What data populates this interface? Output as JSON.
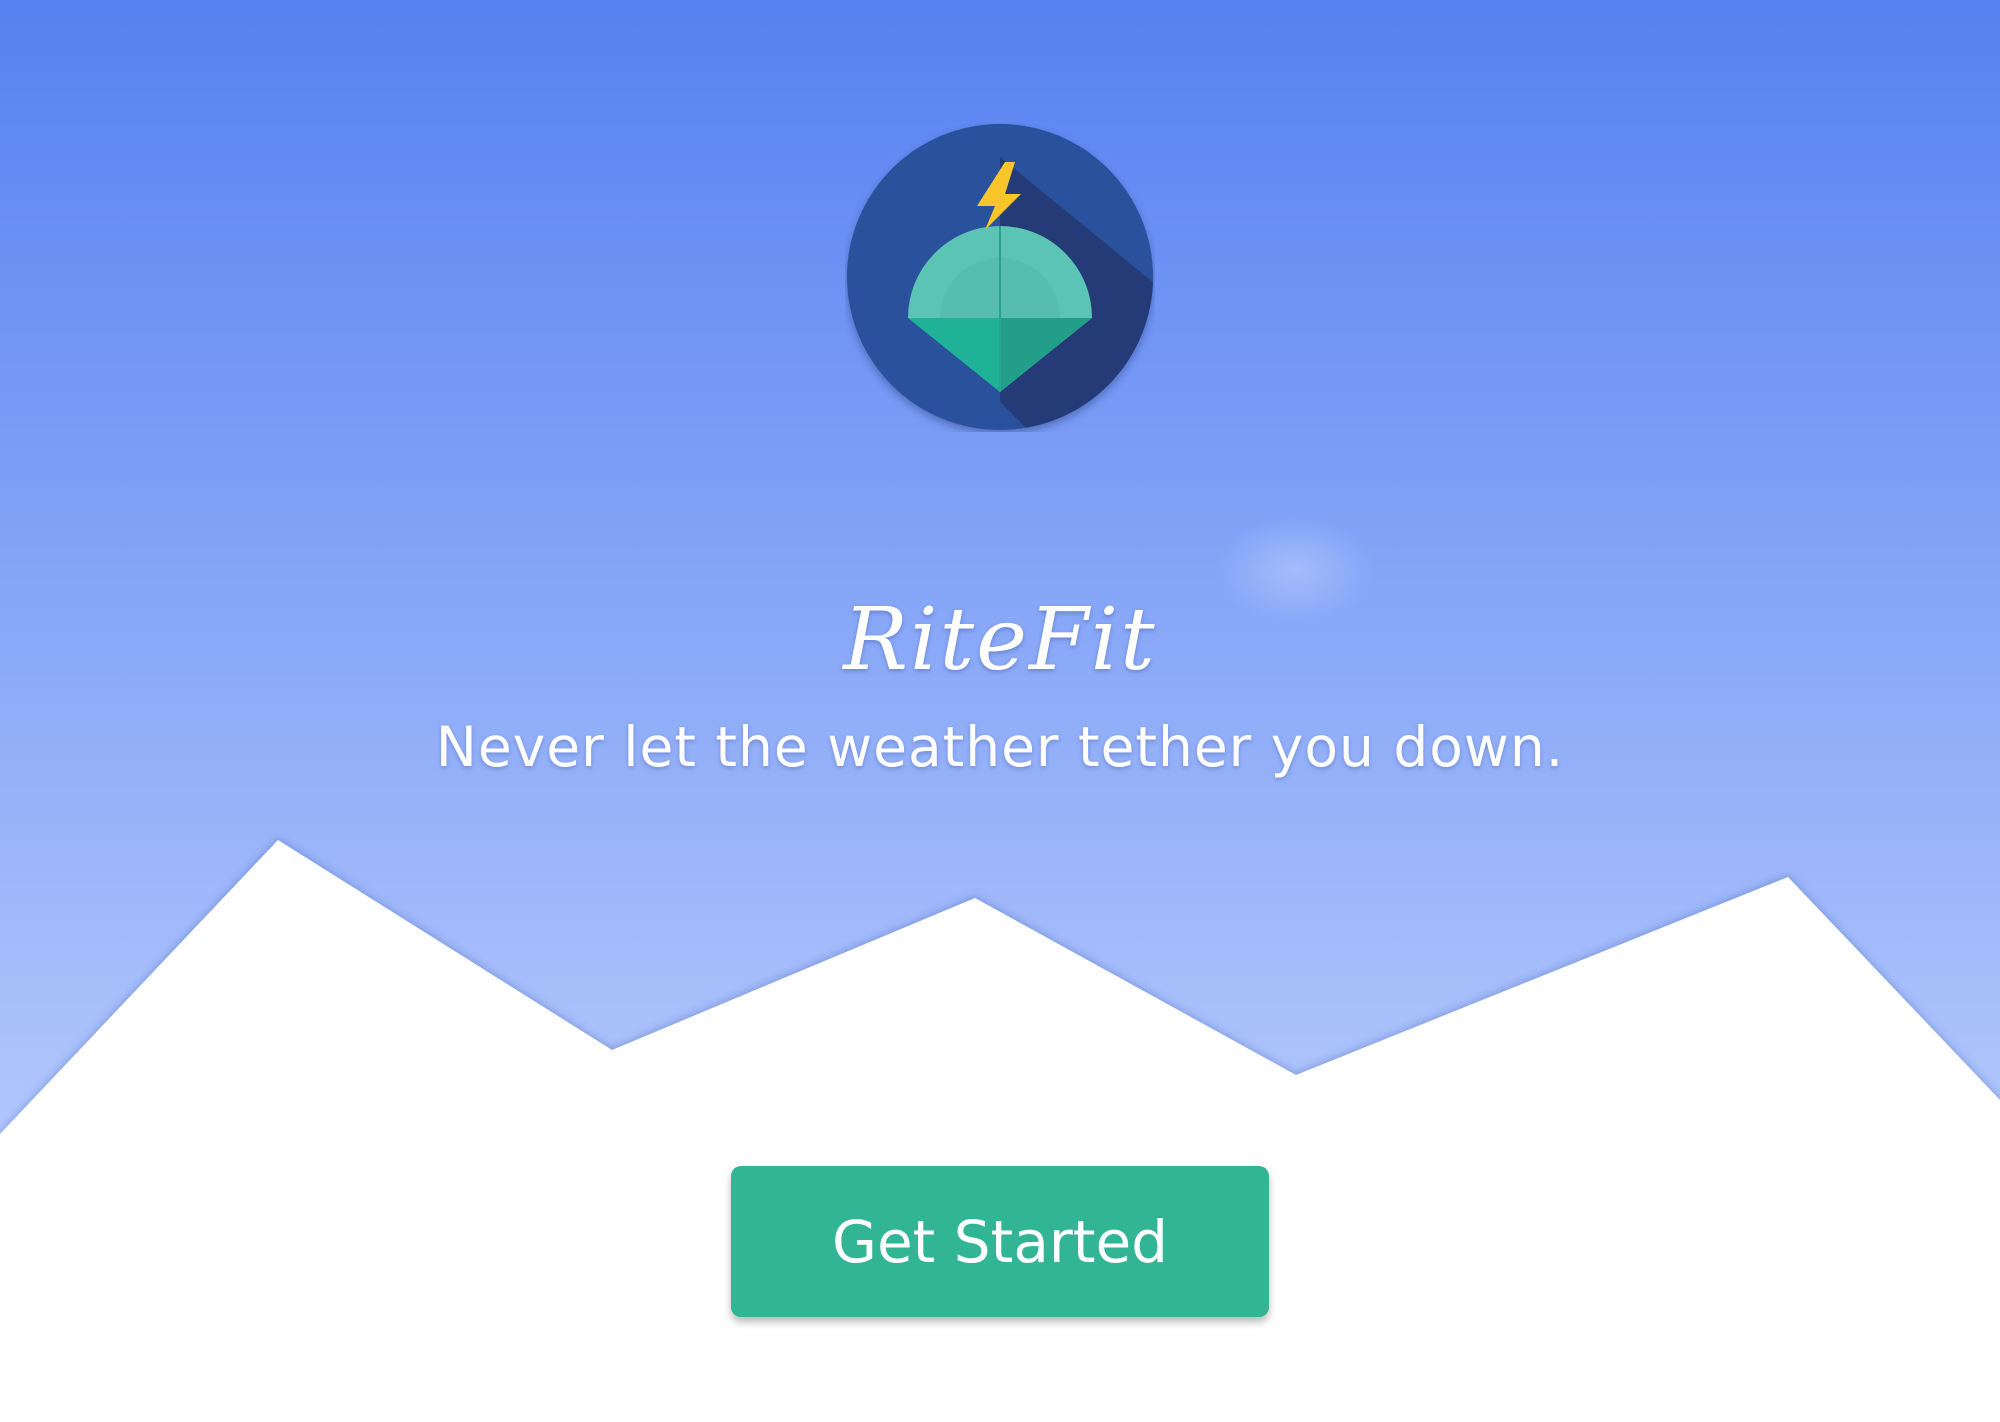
{
  "app": {
    "name": "RiteFit",
    "tagline": "Never let the weather tether you down."
  },
  "hero": {
    "logo_icon": "weather-gem-logo-icon",
    "bolt_icon": "lightning-bolt-icon"
  },
  "actions": {
    "get_started_label": "Get Started"
  },
  "colors": {
    "sky_top": "#5681f1",
    "sky_bottom": "#b2c7fc",
    "mountain": "#ffffff",
    "logo_circle": "#2c519b",
    "logo_shadow": "#253b78",
    "gem_top": "#5cc4b4",
    "gem_bottom": "#20b296",
    "bolt": "#f9c52b",
    "button": "#31b595",
    "text": "#ffffff"
  }
}
